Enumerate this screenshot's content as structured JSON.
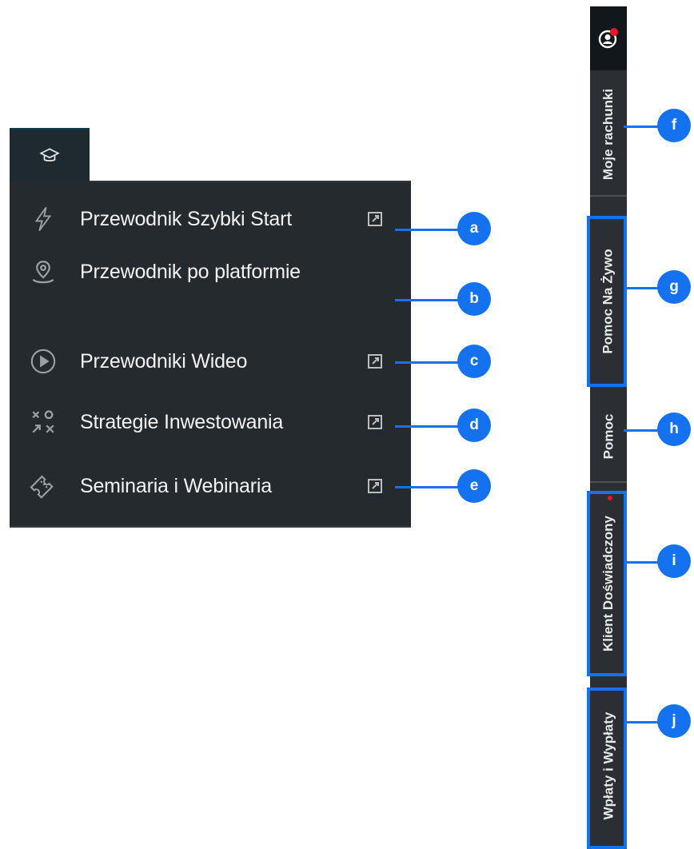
{
  "education_menu": {
    "tab_icon": "graduation-cap-icon",
    "items": [
      {
        "label": "Przewodnik Szybki Start",
        "icon": "lightning-icon",
        "external": true
      },
      {
        "label": "Przewodnik po platformie",
        "icon": "map-pin-icon",
        "external": false
      },
      {
        "label": "Przewodniki Wideo",
        "icon": "play-circle-icon",
        "external": true
      },
      {
        "label": "Strategie Inwestowania",
        "icon": "strategy-xo-icon",
        "external": true
      },
      {
        "label": "Seminaria i Webinaria",
        "icon": "ticket-icon",
        "external": true
      }
    ]
  },
  "side_bar": {
    "account_icon": "user-avatar-icon",
    "notification_color": "#e8142a",
    "items": [
      {
        "label": "Moje rachunki"
      },
      {
        "label": "Pomoc Na Żywo"
      },
      {
        "label": "Pomoc"
      },
      {
        "label": "Klient Doświadczony"
      },
      {
        "label": "Wpłaty i Wypłaty"
      }
    ]
  },
  "callouts": [
    "a",
    "b",
    "c",
    "d",
    "e",
    "f",
    "g",
    "h",
    "i",
    "j"
  ],
  "colors": {
    "accent": "#1472f0",
    "menu_bg": "#252a2e",
    "tab_bg": "#1f2a30",
    "bar_bg": "#2b2f33"
  }
}
